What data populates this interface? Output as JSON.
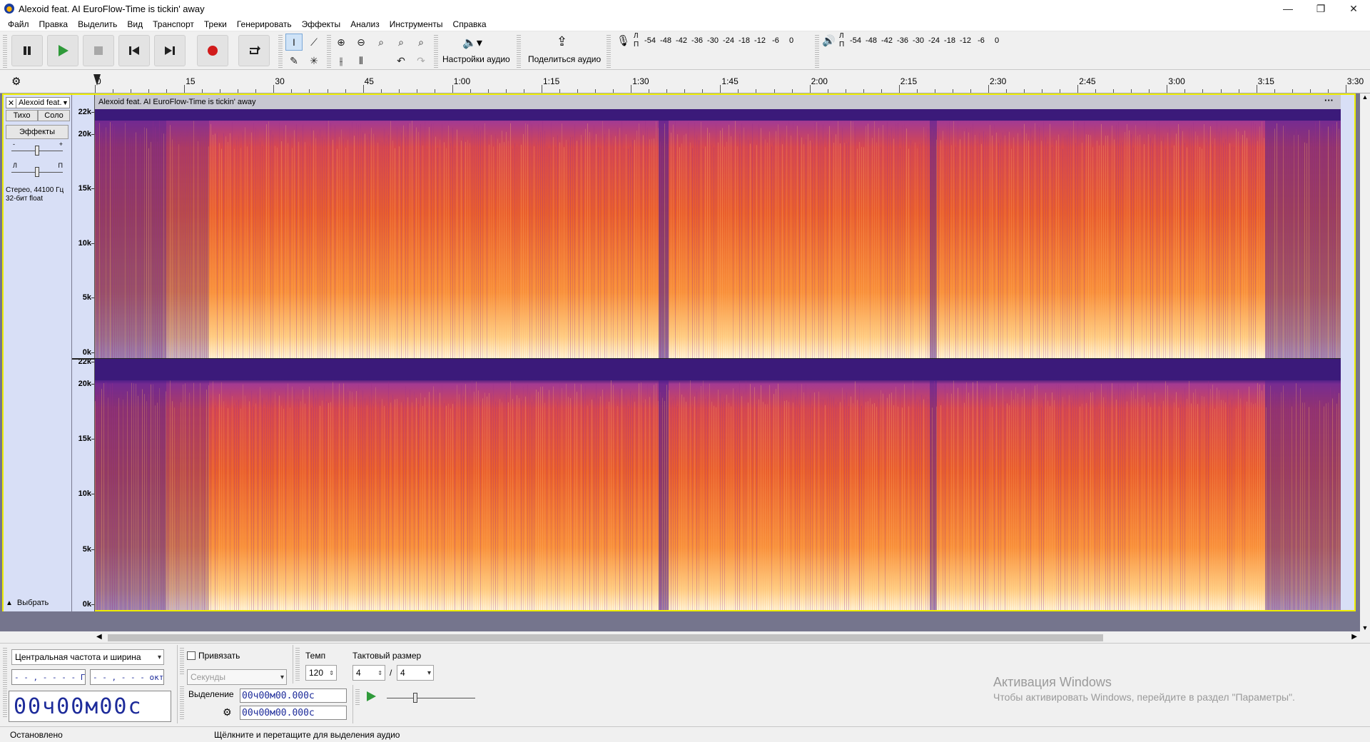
{
  "window": {
    "title": "Alexoid feat. AI EuroFlow-Time is tickin' away",
    "minimize": "—",
    "maximize": "❐",
    "close": "✕"
  },
  "menu": [
    "Файл",
    "Правка",
    "Выделить",
    "Вид",
    "Транспорт",
    "Треки",
    "Генерировать",
    "Эффекты",
    "Анализ",
    "Инструменты",
    "Справка"
  ],
  "toolbar": {
    "audio_settings_label": "Настройки аудио",
    "share_audio_label": "Поделиться аудио",
    "record_meter_ticks": [
      "-54",
      "-48",
      "-42",
      "-36",
      "-30",
      "-24",
      "-18",
      "-12",
      "-6",
      "0"
    ],
    "play_meter_ticks": [
      "-54",
      "-48",
      "-42",
      "-36",
      "-30",
      "-24",
      "-18",
      "-12",
      "-6",
      "0"
    ],
    "meter_l": "Л",
    "meter_r": "П"
  },
  "ruler": {
    "labels": [
      "0",
      "15",
      "30",
      "45",
      "1:00",
      "1:15",
      "1:30",
      "1:45",
      "2:00",
      "2:15",
      "2:30",
      "2:45",
      "3:00",
      "3:15",
      "3:30"
    ]
  },
  "track": {
    "name": "Alexoid feat.",
    "clip_title": "Alexoid feat. AI EuroFlow-Time is tickin' away",
    "mute_label": "Тихо",
    "solo_label": "Соло",
    "effects_label": "Эффекты",
    "gain_minus": "-",
    "gain_plus": "+",
    "pan_left": "Л",
    "pan_right": "П",
    "info_line1": "Стерео, 44100 Гц",
    "info_line2": "32-бит float",
    "select_label": "Выбрать",
    "scale_labels": [
      "22k",
      "20k",
      "15k",
      "10k",
      "5k",
      "0k"
    ]
  },
  "bottom": {
    "spectral_mode": "Центральная частота и ширина",
    "freq_value": "- - , - - - - Гц",
    "octave_value": "- - , - - - октав",
    "snap_label": "Привязать",
    "snap_unit": "Секунды",
    "tempo_label": "Темп",
    "tempo_value": "120",
    "timesig_label": "Тактовый размер",
    "timesig_num": "4",
    "timesig_sep": "/",
    "timesig_den": "4",
    "time_display": "00ч00м00с",
    "selection_label": "Выделение",
    "sel_start": "00ч00м00.000с",
    "sel_end": "00ч00м00.000с"
  },
  "status": {
    "state": "Остановлено",
    "hint": "Щёлкните и перетащите для выделения аудио"
  },
  "watermark": {
    "line1": "Активация Windows",
    "line2": "Чтобы активировать Windows, перейдите в раздел \"Параметры\"."
  },
  "colors": {
    "selection_border": "#eded00",
    "track_panel_bg": "#d8dff6",
    "record_red": "#d11b1b",
    "play_green": "#2f9a3a",
    "spectrum_high": "#fff2c8",
    "spectrum_mid": "#ff7a25",
    "spectrum_low": "#5b1ea0"
  }
}
